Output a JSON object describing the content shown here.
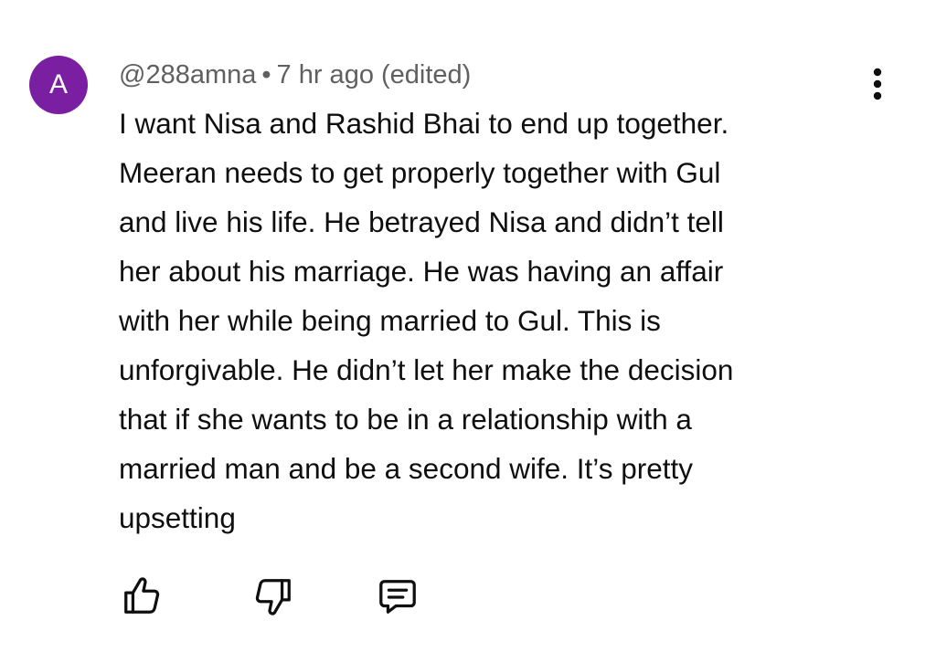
{
  "comment": {
    "avatar_letter": "A",
    "avatar_color": "#7b1fa2",
    "author": "@288amna",
    "separator": "•",
    "timestamp": "7 hr ago (edited)",
    "text_lines": [
      "I want Nisa and Rashid Bhai to end up together.",
      "Meeran needs to get properly together with Gul",
      "and live his life. He betrayed Nisa and didn’t tell",
      "her about his marriage. He was having an affair",
      "with her while being married to Gul. This is",
      "unforgivable. He didn’t let her make the decision",
      "that if she wants to be in a relationship with a",
      "married man and be a second wife. It’s pretty",
      "upsetting"
    ],
    "icons": {
      "more": "more-vertical-icon",
      "like": "thumbs-up-icon",
      "dislike": "thumbs-down-icon",
      "reply": "comment-reply-icon"
    }
  }
}
